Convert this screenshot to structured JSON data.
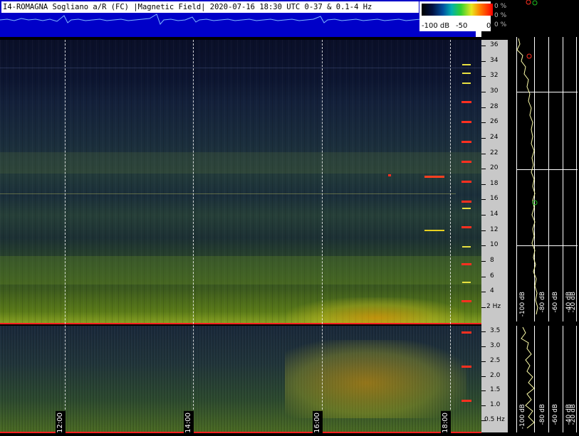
{
  "header": {
    "title": "I4-ROMAGNA  Sogliano a/R (FC) |Magnetic Field| 2020-07-16 18:30 UTC 0-37 & 0.1-4 Hz"
  },
  "colorbar": {
    "min_label": "-100 dB",
    "mid_label": "-50",
    "max_label": "0",
    "percent_labels": [
      "0 %",
      "0 %",
      "0 %"
    ]
  },
  "top_axis": {
    "ticks": [
      "36",
      "34",
      "32",
      "30",
      "28",
      "26",
      "24",
      "22",
      "20",
      "18",
      "16",
      "14",
      "12",
      "10",
      "8",
      "6",
      "4",
      "2 Hz"
    ]
  },
  "bottom_axis": {
    "ticks": [
      "3.5",
      "3.0",
      "2.5",
      "2.0",
      "1.5",
      "1.0",
      "0.5 Hz"
    ]
  },
  "time_labels": [
    "12:00",
    "14:00",
    "16:00",
    "18:00"
  ],
  "power_axis_top": [
    "-100 dB",
    "-80 dB",
    "-60 dB",
    "-40 dB",
    "-20 dB"
  ],
  "power_axis_bottom": [
    "-100 dB",
    "-80 dB",
    "-60 dB",
    "-40 dB",
    "-20 dB"
  ],
  "colors": {
    "header_bg": "#0000c8",
    "separator": "#ff2020",
    "axis_bg": "#c8c8c8",
    "trace": "#ffffaa"
  },
  "icons": {
    "marker_red": "red-circle-icon",
    "marker_green": "green-circle-icon"
  }
}
